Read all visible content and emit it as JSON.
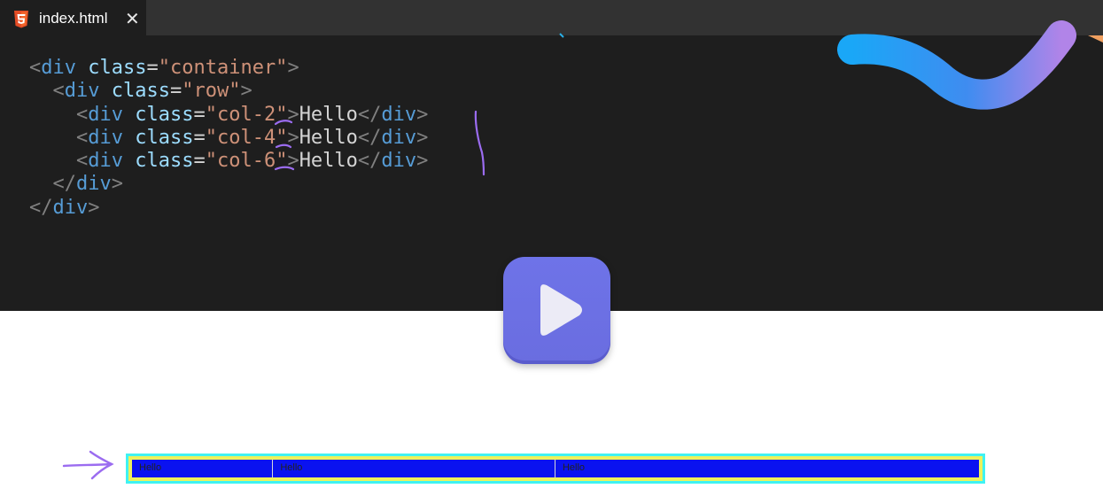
{
  "tab": {
    "filename": "index.html",
    "icon": "html5-icon",
    "close_icon": "close-icon",
    "accent": "#e44d26"
  },
  "code": {
    "lines": [
      [
        "<",
        "div",
        " ",
        "class",
        "=",
        "\"container\"",
        ">",
        "",
        "",
        ""
      ],
      [
        "  <",
        "div",
        " ",
        "class",
        "=",
        "\"row\"",
        ">",
        "",
        "",
        ""
      ],
      [
        "    <",
        "div",
        " ",
        "class",
        "=",
        "\"col-2\"",
        ">",
        "Hello",
        "</",
        "div"
      ],
      [
        "    <",
        "div",
        " ",
        "class",
        "=",
        "\"col-4\"",
        ">",
        "Hello",
        "</",
        "div"
      ],
      [
        "    <",
        "div",
        " ",
        "class",
        "=",
        "\"col-6\"",
        ">",
        "Hello",
        "</",
        "div"
      ],
      [
        "  </",
        "div",
        "",
        "",
        "",
        "",
        ">",
        "",
        "",
        ""
      ],
      [
        "</",
        "div",
        "",
        "",
        "",
        "",
        ">",
        "",
        "",
        ""
      ]
    ],
    "line1": {
      "open": "<",
      "tag": "div",
      "attr": "class",
      "eq": "=",
      "value": "\"container\"",
      "close": ">"
    },
    "line2": {
      "open": "<",
      "tag": "div",
      "attr": "class",
      "eq": "=",
      "value": "\"row\"",
      "close": ">"
    },
    "line3": {
      "open": "<",
      "tag": "div",
      "attr": "class",
      "eq": "=",
      "value": "\"col-2\"",
      "close": ">",
      "text": "Hello",
      "end_open": "</",
      "end_tag": "div",
      "end_close": ">"
    },
    "line4": {
      "open": "<",
      "tag": "div",
      "attr": "class",
      "eq": "=",
      "value": "\"col-4\"",
      "close": ">",
      "text": "Hello",
      "end_open": "</",
      "end_tag": "div",
      "end_close": ">"
    },
    "line5": {
      "open": "<",
      "tag": "div",
      "attr": "class",
      "eq": "=",
      "value": "\"col-6\"",
      "close": ">",
      "text": "Hello",
      "end_open": "</",
      "end_tag": "div",
      "end_close": ">"
    },
    "line6": {
      "open": "</",
      "tag": "div",
      "close": ">"
    },
    "line7": {
      "open": "</",
      "tag": "div",
      "close": ">"
    }
  },
  "play_button": {
    "icon": "play-icon"
  },
  "preview": {
    "arrow_icon": "arrow-right-icon",
    "columns": [
      {
        "label": "Hello"
      },
      {
        "label": "Hello"
      },
      {
        "label": "Hello"
      }
    ]
  },
  "colors": {
    "editor_bg": "#1e1e1e",
    "tabbar_bg": "#323232",
    "tag": "#569cd6",
    "attr": "#9cdcfe",
    "string": "#ce9178",
    "annotation": "#9b6cf0",
    "preview_outer": "#3ff3f3",
    "preview_padding": "#eef15c",
    "preview_row": "#0a12f0"
  }
}
